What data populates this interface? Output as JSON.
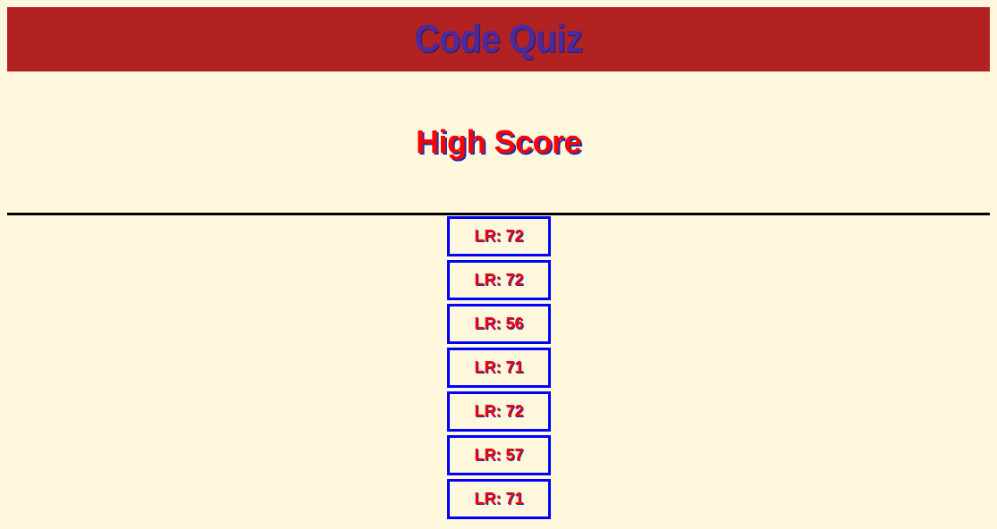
{
  "header": {
    "title": "Code Quiz"
  },
  "main": {
    "heading": "High Score",
    "scores": [
      "LR: 72",
      "LR: 72",
      "LR: 56",
      "LR: 71",
      "LR: 72",
      "LR: 57",
      "LR: 71"
    ]
  },
  "colors": {
    "background": "#fff8dc",
    "header_bg": "#b22222",
    "title_text": "#4b2a9c",
    "heading_text": "#ff0000",
    "score_border": "#0000ff",
    "score_text": "#ff0000"
  }
}
